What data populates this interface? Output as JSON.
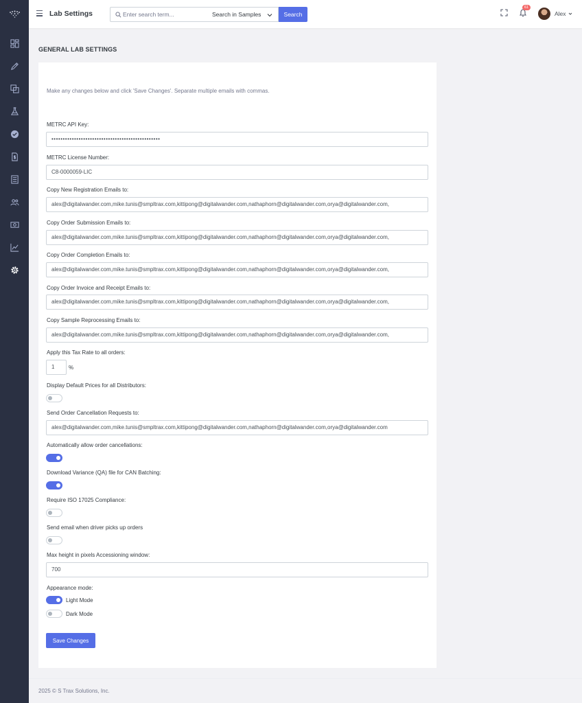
{
  "header": {
    "app_title": "Lab Settings",
    "search_placeholder": "Enter search term...",
    "search_scope": "Search in Samples",
    "search_button": "Search",
    "notification_count": "61",
    "user_name": "Alex"
  },
  "sidebar": {
    "items": [
      "dashboard-icon",
      "pencil-icon",
      "copy-icon",
      "flask-icon",
      "badge-check-icon",
      "file-dollar-icon",
      "list-icon",
      "users-icon",
      "money-icon",
      "chart-icon",
      "gear-icon"
    ]
  },
  "page": {
    "title": "GENERAL LAB SETTINGS",
    "intro": "Make any changes below and click 'Save Changes'. Separate multiple emails with commas."
  },
  "form": {
    "metrc_api_key_label": "METRC API Key:",
    "metrc_api_key_value": "••••••••••••••••••••••••••••••••••••••••••••••••",
    "metrc_license_label": "METRC License Number:",
    "metrc_license_value": "C8-0000059-LIC",
    "new_reg_label": "Copy New Registration Emails to:",
    "new_reg_value": "alex@digitalwander.com,mike.tunis@smpltrax.com,kittipong@digitalwander.com,nathaphorn@digitalwander.com,orya@digitalwander.com,",
    "order_sub_label": "Copy Order Submission Emails to:",
    "order_sub_value": "alex@digitalwander.com,mike.tunis@smpltrax.com,kittipong@digitalwander.com,nathaphorn@digitalwander.com,orya@digitalwander.com,",
    "order_comp_label": "Copy Order Completion Emails to:",
    "order_comp_value": "alex@digitalwander.com,mike.tunis@smpltrax.com,kittipong@digitalwander.com,nathaphorn@digitalwander.com,orya@digitalwander.com,",
    "invoice_label": "Copy Order Invoice and Receipt Emails to:",
    "invoice_value": "alex@digitalwander.com,mike.tunis@smpltrax.com,kittipong@digitalwander.com,nathaphorn@digitalwander.com,orya@digitalwander.com,",
    "reprocess_label": "Copy Sample Reprocessing Emails to:",
    "reprocess_value": "alex@digitalwander.com,mike.tunis@smpltrax.com,kittipong@digitalwander.com,nathaphorn@digitalwander.com,orya@digitalwander.com,",
    "tax_label": "Apply this Tax Rate to all orders:",
    "tax_value": "1",
    "tax_unit": "%",
    "default_prices_label": "Display Default Prices for all Distributors:",
    "default_prices_on": false,
    "cancel_req_label": "Send Order Cancellation Requests to:",
    "cancel_req_value": "alex@digitalwander.com,mike.tunis@smpltrax.com,kittipong@digitalwander.com,nathaphorn@digitalwander.com,orya@digitalwander.com",
    "auto_cancel_label": "Automatically allow order cancellations:",
    "auto_cancel_on": true,
    "variance_label": "Download Variance (QA) file for CAN Batching:",
    "variance_on": true,
    "iso_label": "Require ISO 17025 Compliance:",
    "iso_on": false,
    "driver_label": "Send email when driver picks up orders",
    "driver_on": false,
    "max_height_label": "Max height in pixels Accessioning window:",
    "max_height_value": "700",
    "appearance_label": "Appearance mode:",
    "light_mode_label": "Light Mode",
    "light_mode_on": true,
    "dark_mode_label": "Dark Mode",
    "dark_mode_on": false,
    "save_button": "Save Changes"
  },
  "footer": {
    "text": "2025 © S Trax Solutions, Inc."
  },
  "colors": {
    "accent": "#556ee6",
    "sidebar": "#2a3042",
    "badge": "#f46a6a"
  }
}
